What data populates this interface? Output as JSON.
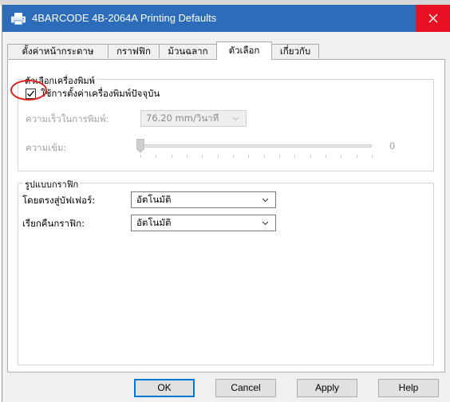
{
  "window": {
    "title": "4BARCODE 4B-2064A Printing Defaults",
    "close_icon": "close-icon",
    "app_icon": "printer-icon"
  },
  "tabs": [
    {
      "label": "ตั้งค่าหน้ากระดาษ",
      "active": false
    },
    {
      "label": "กราฟฟิก",
      "active": false
    },
    {
      "label": "ม้วนฉลาก",
      "active": false
    },
    {
      "label": "ตัวเลือก",
      "active": true
    },
    {
      "label": "เกี่ยวกับ",
      "active": false
    }
  ],
  "printer_options": {
    "group_title": "ตัวเลือกเครื่องพิมพ์",
    "use_current_settings_label": "ใช้การตั้งค่าเครื่องพิมพ์ปัจจุบัน",
    "use_current_settings_checked": true,
    "speed_label": "ความเร็วในการพิมพ์:",
    "speed_value": "76.20 mm/วินาที",
    "darkness_label": "ความเข้ม:",
    "darkness_value": "0"
  },
  "graphics_mode": {
    "group_title": "รูปแบบกราฟิก",
    "direct_buffer_label": "โดยตรงสู่บัฟเฟอร์:",
    "direct_buffer_value": "อัตโนมัติ",
    "stored_graphics_label": "เรียกคืนกราฟิก:",
    "stored_graphics_value": "อัตโนมัติ"
  },
  "buttons": {
    "ok": "OK",
    "cancel": "Cancel",
    "apply": "Apply",
    "help": "Help"
  },
  "colors": {
    "titlebar": "#2c6cb8",
    "close_hover": "#e81123",
    "annotation_circle": "#e0201a",
    "default_button_border": "#0078d7"
  }
}
